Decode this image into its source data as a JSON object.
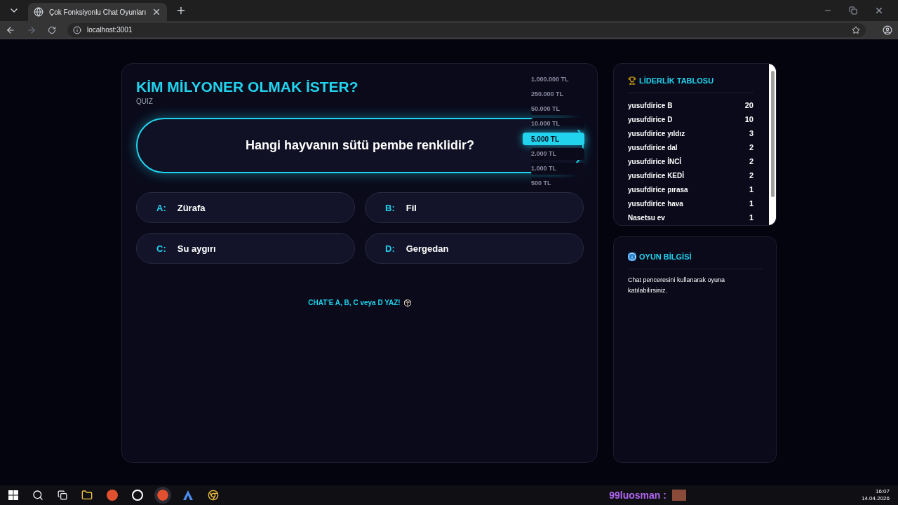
{
  "browser": {
    "tab_title": "Çok Fonksiyonlu Chat Oyunları",
    "url": "localhost:3001"
  },
  "game": {
    "title": "KİM MİLYONER OLMAK İSTER?",
    "subtitle": "QUIZ",
    "question": "Hangi hayvanın sütü pembe renklidir?",
    "ladder": [
      {
        "amount": "1.000.000 TL",
        "selected": false
      },
      {
        "amount": "250.000 TL",
        "selected": false
      },
      {
        "amount": "50.000 TL",
        "selected": false
      },
      {
        "amount": "10.000 TL",
        "selected": false
      },
      {
        "amount": "5.000 TL",
        "selected": true
      },
      {
        "amount": "2.000 TL",
        "selected": false
      },
      {
        "amount": "1.000 TL",
        "selected": false
      },
      {
        "amount": "500 TL",
        "selected": false
      }
    ],
    "answers": [
      {
        "letter": "A:",
        "text": "Zürafa"
      },
      {
        "letter": "B:",
        "text": "Fil"
      },
      {
        "letter": "C:",
        "text": "Su aygırı"
      },
      {
        "letter": "D:",
        "text": "Gergedan"
      }
    ],
    "instruction": "CHAT'E A, B, C veya D YAZ!"
  },
  "leaderboard": {
    "title": "LİDERLİK TABLOSU",
    "rows": [
      {
        "name": "yusufdirice B",
        "score": "20"
      },
      {
        "name": "yusufdirice D",
        "score": "10"
      },
      {
        "name": "yusufdirice yıldız",
        "score": "3"
      },
      {
        "name": "yusufdirice dal",
        "score": "2"
      },
      {
        "name": "yusufdirice İNCİ",
        "score": "2"
      },
      {
        "name": "yusufdirice KEDİ",
        "score": "2"
      },
      {
        "name": "yusufdirice pırasa",
        "score": "1"
      },
      {
        "name": "yusufdirice hava",
        "score": "1"
      },
      {
        "name": "Nasetsu ev",
        "score": "1"
      }
    ]
  },
  "info": {
    "title": "OYUN BİLGİSİ",
    "text": "Chat penceresini kullanarak oyuna katılabilirsiniz."
  },
  "taskbar": {
    "chat_user": "99luosman :",
    "time": "16:07",
    "date": "14.04.2026"
  }
}
